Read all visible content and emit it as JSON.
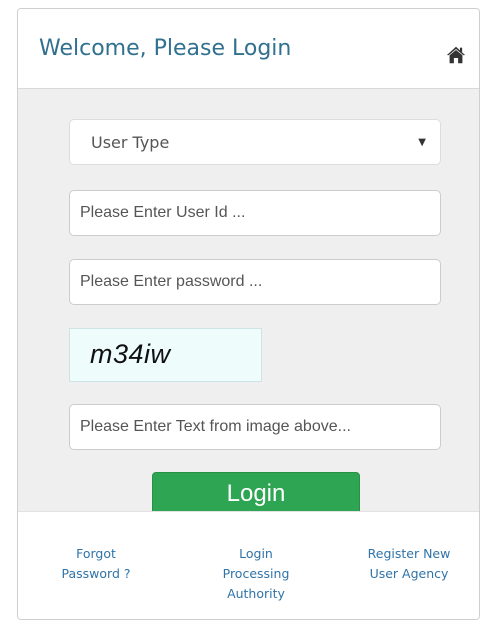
{
  "header": {
    "title": "Welcome, Please Login",
    "icon": "home-icon",
    "title_color": "#31708f"
  },
  "form": {
    "user_type": {
      "selected": "User Type"
    },
    "user_id": {
      "placeholder": "Please Enter User Id ..."
    },
    "password": {
      "placeholder": "Please Enter password ..."
    },
    "captcha": {
      "text": "m34iw",
      "input_placeholder": "Please Enter Text from image above..."
    },
    "login_label": "Login",
    "login_color": "#2ea552"
  },
  "footer": {
    "forgot_password": [
      "Forgot",
      "Password ?"
    ],
    "login_authority": [
      "Login",
      "Processing",
      "Authority"
    ],
    "register": [
      "Register New",
      "User Agency"
    ],
    "link_color": "#2f73a8"
  }
}
